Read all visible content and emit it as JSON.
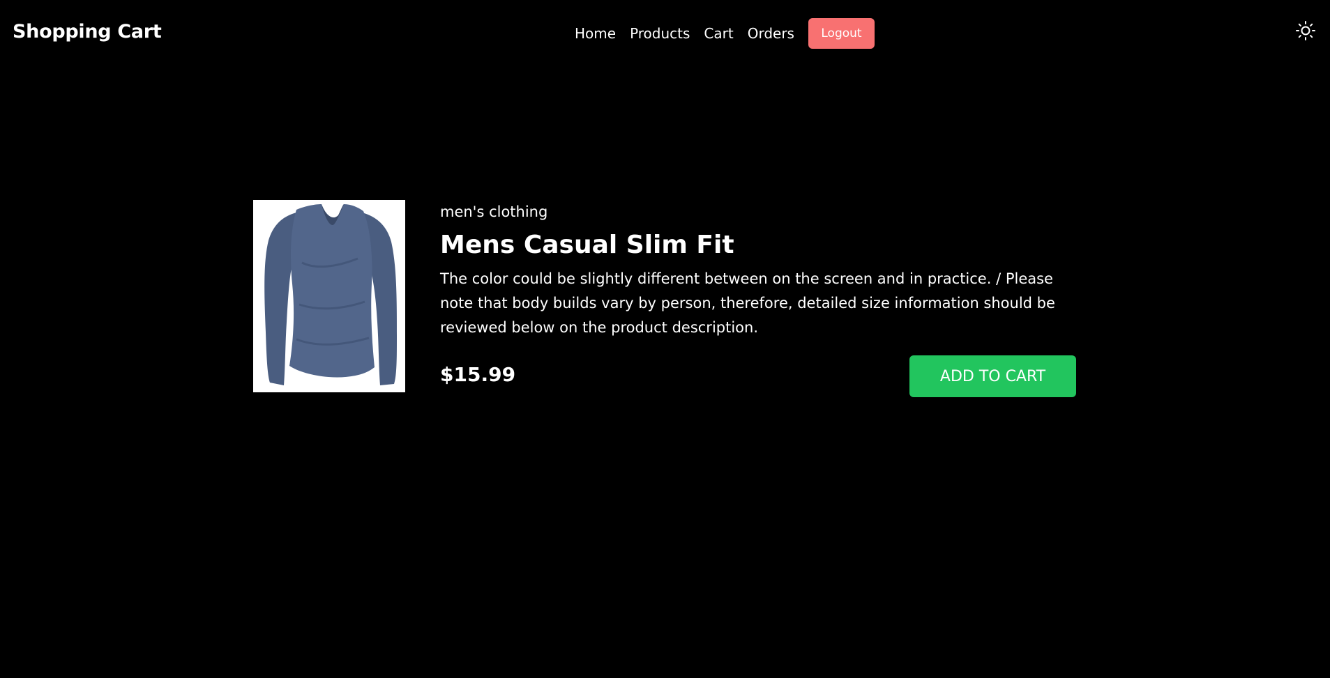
{
  "header": {
    "brand": "Shopping Cart",
    "nav": [
      {
        "label": "Home"
      },
      {
        "label": "Products"
      },
      {
        "label": "Cart"
      },
      {
        "label": "Orders"
      }
    ],
    "logout_label": "Logout",
    "theme_icon": "sun-icon"
  },
  "product": {
    "category": "men's clothing",
    "title": "Mens Casual Slim Fit",
    "description": "The color could be slightly different between on the screen and in practice. / Please note that body builds vary by person, therefore, detailed size information should be reviewed below on the product description.",
    "price": "$15.99",
    "add_to_cart_label": "ADD TO CART",
    "image_icon": "long-sleeve-shirt-image"
  },
  "colors": {
    "background": "#000000",
    "text": "#ffffff",
    "logout": "#f87171",
    "add_to_cart": "#22c55e",
    "shirt": "#4f6387"
  }
}
